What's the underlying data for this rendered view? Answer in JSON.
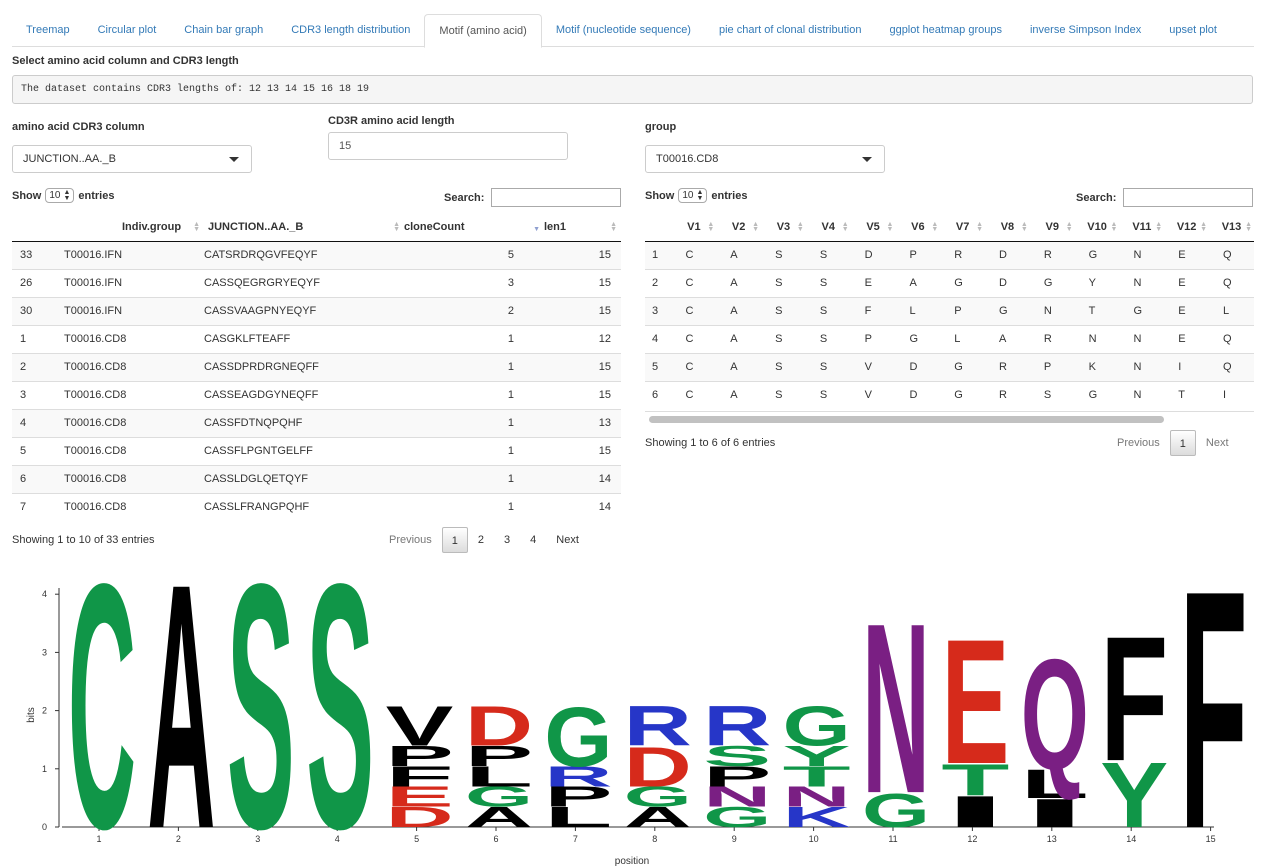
{
  "tabs": [
    {
      "label": "Treemap"
    },
    {
      "label": "Circular plot"
    },
    {
      "label": "Chain bar graph"
    },
    {
      "label": "CDR3 length distribution"
    },
    {
      "label": "Motif (amino acid)",
      "active": true
    },
    {
      "label": "Motif (nucleotide sequence)"
    },
    {
      "label": "pie chart of clonal distribution"
    },
    {
      "label": "ggplot heatmap groups"
    },
    {
      "label": "inverse Simpson Index"
    },
    {
      "label": "upset plot"
    }
  ],
  "select_heading": "Select amino acid column and CDR3 length",
  "dataset_info": "The dataset contains CDR3 lengths of: 12 13 14 15 16 18 19",
  "controls": {
    "aa_column_label": "amino acid CDR3 column",
    "aa_column_value": "JUNCTION..AA._B",
    "length_label": "CD3R amino acid length",
    "length_value": "15",
    "group_label": "group",
    "group_value": "T00016.CD8"
  },
  "left_table": {
    "show_label": "Show",
    "entries_value": "10",
    "entries_label": "entries",
    "search_label": "Search:",
    "headers": [
      "",
      "Indiv.group",
      "JUNCTION..AA._B",
      "cloneCount",
      "len1"
    ],
    "rows": [
      [
        "33",
        "T00016.IFN",
        "CATSRDRQGVFEQYF",
        "5",
        "15"
      ],
      [
        "26",
        "T00016.IFN",
        "CASSQEGRGRYEQYF",
        "3",
        "15"
      ],
      [
        "30",
        "T00016.IFN",
        "CASSVAAGPNYEQYF",
        "2",
        "15"
      ],
      [
        "1",
        "T00016.CD8",
        "CASGKLFTEAFF",
        "1",
        "12"
      ],
      [
        "2",
        "T00016.CD8",
        "CASSDPRDRGNEQFF",
        "1",
        "15"
      ],
      [
        "3",
        "T00016.CD8",
        "CASSEAGDGYNEQFF",
        "1",
        "15"
      ],
      [
        "4",
        "T00016.CD8",
        "CASSFDTNQPQHF",
        "1",
        "13"
      ],
      [
        "5",
        "T00016.CD8",
        "CASSFLPGNTGELFF",
        "1",
        "15"
      ],
      [
        "6",
        "T00016.CD8",
        "CASSLDGLQETQYF",
        "1",
        "14"
      ],
      [
        "7",
        "T00016.CD8",
        "CASSLFRANGPQHF",
        "1",
        "14"
      ]
    ],
    "info": "Showing 1 to 10 of 33 entries",
    "pager": {
      "previous": "Previous",
      "pages": [
        "1",
        "2",
        "3",
        "4"
      ],
      "next": "Next"
    }
  },
  "right_table": {
    "show_label": "Show",
    "entries_value": "10",
    "entries_label": "entries",
    "search_label": "Search:",
    "headers": [
      "",
      "V1",
      "V2",
      "V3",
      "V4",
      "V5",
      "V6",
      "V7",
      "V8",
      "V9",
      "V10",
      "V11",
      "V12",
      "V13"
    ],
    "rows": [
      [
        "1",
        "C",
        "A",
        "S",
        "S",
        "D",
        "P",
        "R",
        "D",
        "R",
        "G",
        "N",
        "E",
        "Q"
      ],
      [
        "2",
        "C",
        "A",
        "S",
        "S",
        "E",
        "A",
        "G",
        "D",
        "G",
        "Y",
        "N",
        "E",
        "Q"
      ],
      [
        "3",
        "C",
        "A",
        "S",
        "S",
        "F",
        "L",
        "P",
        "G",
        "N",
        "T",
        "G",
        "E",
        "L"
      ],
      [
        "4",
        "C",
        "A",
        "S",
        "S",
        "P",
        "G",
        "L",
        "A",
        "R",
        "N",
        "N",
        "E",
        "Q"
      ],
      [
        "5",
        "C",
        "A",
        "S",
        "S",
        "V",
        "D",
        "G",
        "R",
        "P",
        "K",
        "N",
        "I",
        "Q"
      ],
      [
        "6",
        "C",
        "A",
        "S",
        "S",
        "V",
        "D",
        "G",
        "R",
        "S",
        "G",
        "N",
        "T",
        "I"
      ]
    ],
    "info": "Showing 1 to 6 of 6 entries",
    "pager": {
      "previous": "Previous",
      "pages": [
        "1"
      ],
      "next": "Next"
    }
  },
  "chart_data": {
    "type": "sequence-logo",
    "xlabel": "position",
    "ylabel": "bits",
    "ylim": [
      0,
      4.2
    ],
    "yticks": [
      "0",
      "1",
      "2",
      "3",
      "4"
    ],
    "positions": [
      "1",
      "2",
      "3",
      "4",
      "5",
      "6",
      "7",
      "8",
      "9",
      "10",
      "11",
      "12",
      "13",
      "14",
      "15"
    ],
    "colors": {
      "green": "#109648",
      "black": "#000000",
      "red": "#d62a1b",
      "blue": "#2636c8",
      "purple": "#7a1f83"
    },
    "stacks": [
      [
        {
          "letter": "C",
          "bits": 4.32,
          "color": "green"
        }
      ],
      [
        {
          "letter": "A",
          "bits": 4.32,
          "color": "black"
        }
      ],
      [
        {
          "letter": "S",
          "bits": 4.32,
          "color": "green"
        }
      ],
      [
        {
          "letter": "S",
          "bits": 4.32,
          "color": "green"
        }
      ],
      [
        {
          "letter": "D",
          "bits": 0.35,
          "color": "red"
        },
        {
          "letter": "E",
          "bits": 0.35,
          "color": "red"
        },
        {
          "letter": "F",
          "bits": 0.35,
          "color": "black"
        },
        {
          "letter": "P",
          "bits": 0.35,
          "color": "black"
        },
        {
          "letter": "V",
          "bits": 0.7,
          "color": "black"
        }
      ],
      [
        {
          "letter": "A",
          "bits": 0.35,
          "color": "black"
        },
        {
          "letter": "G",
          "bits": 0.35,
          "color": "green"
        },
        {
          "letter": "L",
          "bits": 0.35,
          "color": "black"
        },
        {
          "letter": "P",
          "bits": 0.35,
          "color": "black"
        },
        {
          "letter": "D",
          "bits": 0.7,
          "color": "red"
        }
      ],
      [
        {
          "letter": "L",
          "bits": 0.35,
          "color": "black"
        },
        {
          "letter": "P",
          "bits": 0.35,
          "color": "black"
        },
        {
          "letter": "R",
          "bits": 0.35,
          "color": "blue"
        },
        {
          "letter": "G",
          "bits": 1.05,
          "color": "green"
        }
      ],
      [
        {
          "letter": "A",
          "bits": 0.35,
          "color": "black"
        },
        {
          "letter": "G",
          "bits": 0.35,
          "color": "green"
        },
        {
          "letter": "D",
          "bits": 0.7,
          "color": "red"
        },
        {
          "letter": "R",
          "bits": 0.7,
          "color": "blue"
        }
      ],
      [
        {
          "letter": "G",
          "bits": 0.35,
          "color": "green"
        },
        {
          "letter": "N",
          "bits": 0.35,
          "color": "purple"
        },
        {
          "letter": "P",
          "bits": 0.35,
          "color": "black"
        },
        {
          "letter": "S",
          "bits": 0.35,
          "color": "green"
        },
        {
          "letter": "R",
          "bits": 0.7,
          "color": "blue"
        }
      ],
      [
        {
          "letter": "K",
          "bits": 0.35,
          "color": "blue"
        },
        {
          "letter": "N",
          "bits": 0.35,
          "color": "purple"
        },
        {
          "letter": "T",
          "bits": 0.35,
          "color": "green"
        },
        {
          "letter": "Y",
          "bits": 0.35,
          "color": "green"
        },
        {
          "letter": "G",
          "bits": 0.7,
          "color": "green"
        }
      ],
      [
        {
          "letter": "G",
          "bits": 0.6,
          "color": "green"
        },
        {
          "letter": "N",
          "bits": 3.0,
          "color": "purple"
        }
      ],
      [
        {
          "letter": "I",
          "bits": 0.55,
          "color": "black"
        },
        {
          "letter": "T",
          "bits": 0.55,
          "color": "green"
        },
        {
          "letter": "E",
          "bits": 2.2,
          "color": "red"
        }
      ],
      [
        {
          "letter": "I",
          "bits": 0.5,
          "color": "black"
        },
        {
          "letter": "L",
          "bits": 0.5,
          "color": "black"
        },
        {
          "letter": "Q",
          "bits": 1.95,
          "color": "purple"
        }
      ],
      [
        {
          "letter": "Y",
          "bits": 1.15,
          "color": "green"
        },
        {
          "letter": "F",
          "bits": 2.2,
          "color": "black"
        }
      ],
      [
        {
          "letter": "F",
          "bits": 4.2,
          "color": "black"
        }
      ]
    ]
  }
}
